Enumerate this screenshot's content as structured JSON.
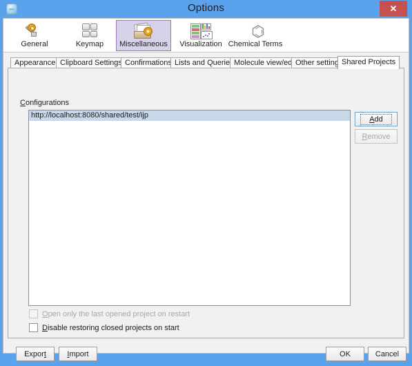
{
  "window": {
    "title": "Options",
    "app_icon": "app-window-icon",
    "close_label": "✕"
  },
  "toolbar": {
    "items": [
      {
        "label": "General",
        "icon": "gear-wrench-icon",
        "selected": false
      },
      {
        "label": "Keymap",
        "icon": "keyboard-keys-icon",
        "selected": false
      },
      {
        "label": "Miscellaneous",
        "icon": "documents-gear-icon",
        "selected": true
      },
      {
        "label": "Visualization",
        "icon": "charts-icon",
        "selected": false
      },
      {
        "label": "Chemical Terms",
        "icon": "benzene-ring-icon",
        "selected": false
      }
    ]
  },
  "tabs": [
    {
      "label": "Appearance",
      "active": false
    },
    {
      "label": "Clipboard Settings",
      "active": false
    },
    {
      "label": "Confirmations",
      "active": false
    },
    {
      "label": "Lists and Queries",
      "active": false
    },
    {
      "label": "Molecule view/edit",
      "active": false
    },
    {
      "label": "Other settings",
      "active": false
    },
    {
      "label": "Shared Projects",
      "active": true
    }
  ],
  "shared_projects": {
    "group_label": "Configurations",
    "group_label_mnemonic": "C",
    "list": {
      "rows": [
        {
          "value": "http://localhost:8080/shared/test/ijp",
          "selected": true
        }
      ]
    },
    "buttons": {
      "add": {
        "label": "Add",
        "mnemonic": "A",
        "enabled": true,
        "focused": true
      },
      "remove": {
        "label": "Remove",
        "mnemonic": "R",
        "enabled": false,
        "focused": false
      }
    },
    "checkboxes": [
      {
        "label": "Open only the last opened project on restart",
        "mnemonic": "O",
        "checked": false,
        "enabled": false
      },
      {
        "label": "Disable restoring closed projects on start",
        "mnemonic": "D",
        "checked": false,
        "enabled": true
      }
    ]
  },
  "footer": {
    "export_label": "Export",
    "import_label": "Import",
    "ok_label": "OK",
    "cancel_label": "Cancel"
  },
  "colors": {
    "titlebar": "#5aa3ec",
    "close_button": "#c75050",
    "selected_tool": "#d6d2ea",
    "selected_tool_border": "#9a78b8",
    "list_selection": "#c8d8e8",
    "panel": "#f1f1f1"
  }
}
